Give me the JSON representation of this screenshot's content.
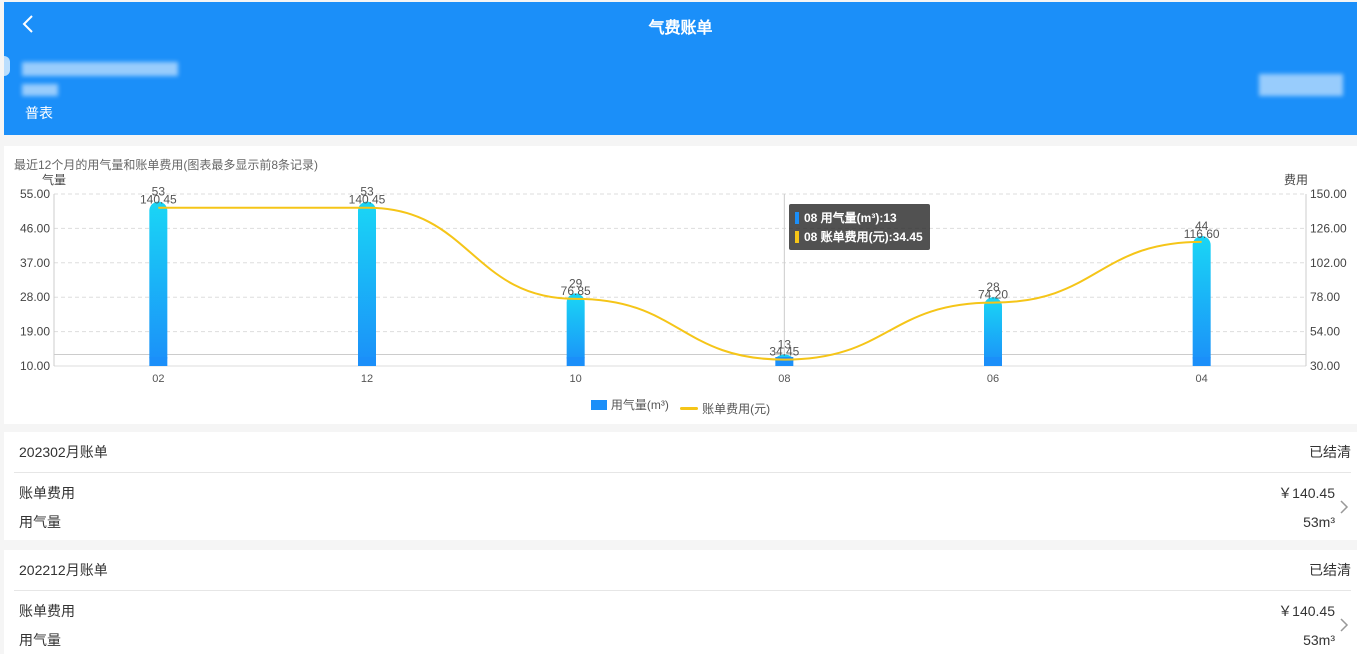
{
  "header": {
    "title": "气费账单",
    "meter_type": "普表"
  },
  "chart_caption": "最近12个月的用气量和账单费用(图表最多显示前8条记录)",
  "chart_data": {
    "type": "bar",
    "categories": [
      "02",
      "12",
      "10",
      "08",
      "06",
      "04"
    ],
    "series": [
      {
        "name": "用气量(m³)",
        "type": "bar",
        "axis": "left",
        "values": [
          53,
          53,
          29,
          13,
          28,
          44
        ]
      },
      {
        "name": "账单费用(元)",
        "type": "line",
        "axis": "right",
        "values": [
          140.45,
          140.45,
          76.85,
          34.45,
          74.2,
          116.6
        ]
      }
    ],
    "ylabel_left": "气量",
    "ylabel_right": "费用",
    "ylim_left": [
      10,
      55
    ],
    "ylim_right": [
      30,
      150
    ],
    "yticks_left": [
      "55.00",
      "46.00",
      "37.00",
      "28.00",
      "19.00",
      "10.00"
    ],
    "yticks_right": [
      "150.00",
      "126.00",
      "102.00",
      "78.00",
      "54.00",
      "30.00"
    ],
    "bar_labels": [
      "53",
      "53",
      "29",
      "13",
      "28",
      "44"
    ],
    "line_labels": [
      "140.45",
      "140.45",
      "76.85",
      "34.45",
      "74.20",
      "116.60"
    ],
    "grid": true,
    "legend": "bottom",
    "colors": {
      "bar_top": "#1ad6f5",
      "bar_bottom": "#1b8ff9",
      "line": "#f5c518"
    }
  },
  "tooltip": {
    "line1": "08 用气量(m³):13",
    "line2": "08 账单费用(元):34.45"
  },
  "legend": {
    "bar_label": "用气量(m³)",
    "line_label": "账单费用(元)"
  },
  "bills": [
    {
      "month": "202302月账单",
      "status": "已结清",
      "fee_label": "账单费用",
      "fee_value": "￥140.45",
      "usage_label": "用气量",
      "usage_value": "53m³"
    },
    {
      "month": "202212月账单",
      "status": "已结清",
      "fee_label": "账单费用",
      "fee_value": "￥140.45",
      "usage_label": "用气量",
      "usage_value": "53m³"
    }
  ]
}
